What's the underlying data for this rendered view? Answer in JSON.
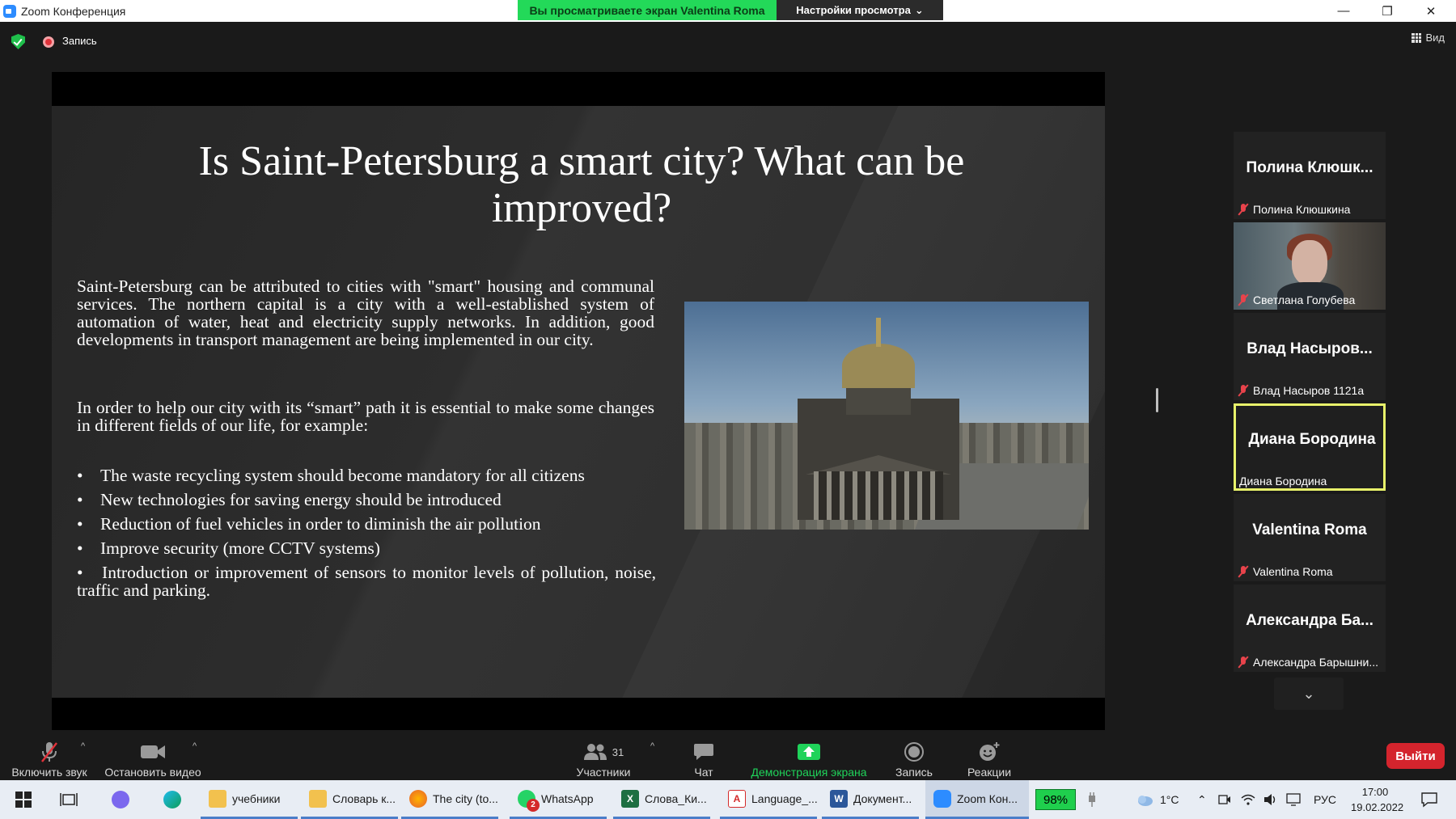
{
  "window": {
    "title": "Zoom Конференция",
    "banner_viewing": "Вы просматриваете экран Valentina Roma",
    "banner_settings": "Настройки просмотра",
    "minimize_icon": "—",
    "maximize_icon": "❐",
    "close_icon": "✕"
  },
  "topbar": {
    "record_label": "Запись",
    "view_label": "Вид"
  },
  "slide": {
    "title": "Is Saint-Petersburg a smart city? What can be improved?",
    "paragraph1": "Saint-Petersburg can be attributed to cities with \"smart\" housing and communal services. The northern capital is a city with a well-established system of automation of water, heat and electricity supply networks. In addition, good developments in transport management are being implemented in our city.",
    "paragraph2": "In order to help our city with its “smart” path it is essential to make some changes in different fields of our life, for example:",
    "bullet_char": "•",
    "bullets": [
      "The waste recycling system should become mandatory for all citizens",
      "New technologies for saving energy should be introduced",
      "Reduction of fuel vehicles in order to diminish the air pollution",
      "Improve security (more CCTV systems)"
    ],
    "last_bullet": "Introduction or improvement of sensors to monitor levels of pollution, noise, traffic and parking."
  },
  "participants": [
    {
      "big": "Полина Клюшк...",
      "label": "Полина Клюшкина",
      "muted": true
    },
    {
      "big": "",
      "label": "Светлана Голубева",
      "muted": true,
      "video": true
    },
    {
      "big": "Влад Насыров...",
      "label": "Влад Насыров 1121а",
      "muted": true
    },
    {
      "big": "Диана Бородина",
      "label": "Диана Бородина",
      "muted": false,
      "active": true
    },
    {
      "big": "Valentina Roma",
      "label": "Valentina Roma",
      "muted": true
    },
    {
      "big": "Александра Ба...",
      "label": "Александра Барышни...",
      "muted": true
    }
  ],
  "gallery": {
    "more_icon": "⌄"
  },
  "toolbar": {
    "unmute": "Включить звук",
    "stop_video": "Остановить видео",
    "participants": "Участники",
    "participants_count": "31",
    "chat": "Чат",
    "share_screen": "Демонстрация экрана",
    "record": "Запись",
    "reactions": "Реакции",
    "leave": "Выйти",
    "caret": "^"
  },
  "taskbar": {
    "apps": [
      {
        "label": "учебники",
        "color": "#f2c14e"
      },
      {
        "label": "Словарь к...",
        "color": "#f2c14e"
      },
      {
        "label": "The city (to...",
        "color": "#e8612c"
      },
      {
        "label": "WhatsApp",
        "color": "#25d366",
        "badge": "2"
      },
      {
        "label": "Слова_Ки...",
        "color": "#1d6f42",
        "glyph": "X"
      },
      {
        "label": "Language_...",
        "color": "#ffffff",
        "glyph": "A"
      },
      {
        "label": "Документ...",
        "color": "#2b579a",
        "glyph": "W"
      },
      {
        "label": "Zoom Кон...",
        "color": "#2d8cff"
      }
    ],
    "battery": "98%",
    "temperature": "1°C",
    "language": "РУС",
    "time": "17:00",
    "date": "19.02.2022"
  }
}
